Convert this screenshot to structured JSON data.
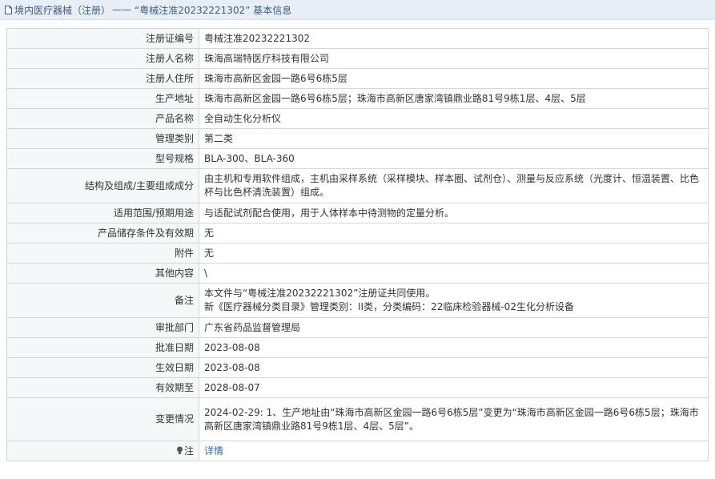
{
  "header": {
    "breadcrumb_prefix": "境内医疗器械（注册）",
    "separator": "——",
    "title": "“粤械注准20232221302” 基本信息"
  },
  "rows": [
    {
      "label": "注册证编号",
      "value": "粤械注准20232221302"
    },
    {
      "label": "注册人名称",
      "value": "珠海高瑞特医疗科技有限公司"
    },
    {
      "label": "注册人住所",
      "value": "珠海市高新区金园一路6号6栋5层"
    },
    {
      "label": "生产地址",
      "value": "珠海市高新区金园一路6号6栋5层；珠海市高新区唐家湾镇鼎业路81号9栋1层、4层、5层"
    },
    {
      "label": "产品名称",
      "value": "全自动生化分析仪"
    },
    {
      "label": "管理类别",
      "value": "第二类"
    },
    {
      "label": "型号规格",
      "value": "BLA-300、BLA-360"
    },
    {
      "label": "结构及组成/主要组成成分",
      "value": "由主机和专用软件组成，主机由采样系统（采样模块、样本圈、试剂仓）、测量与反应系统（光度计、恒温装置、比色杯与比色杯清洗装置）组成。"
    },
    {
      "label": "适用范围/预期用途",
      "value": "与适配试剂配合使用，用于人体样本中待测物的定量分析。"
    },
    {
      "label": "产品储存条件及有效期",
      "value": "无"
    },
    {
      "label": "附件",
      "value": "无"
    },
    {
      "label": "其他内容",
      "value": "\\"
    },
    {
      "label": "备注",
      "value_lines": [
        "本文件与“粤械注准20232221302”注册证共同使用。",
        "新《医疗器械分类目录》管理类别：II类，分类编码：22临床检验器械-02生化分析设备"
      ]
    },
    {
      "label": "审批部门",
      "value": "广东省药品监督管理局"
    },
    {
      "label": "批准日期",
      "value": "2023-08-08"
    },
    {
      "label": "生效日期",
      "value": "2023-08-08"
    },
    {
      "label": "有效期至",
      "value": "2028-08-07"
    },
    {
      "label": "变更情况",
      "value": "2024-02-29: 1、生产地址由“珠海市高新区金园一路6号6栋5层”变更为“珠海市高新区金园一路6号6栋5层；珠海市高新区唐家湾镇鼎业路81号9栋1层、4层、5层”。"
    }
  ],
  "note": {
    "label": "注",
    "icon": "bulb-icon",
    "link_text": "详情"
  },
  "colors": {
    "header_bg": "#e8eef5",
    "header_text": "#3a5d86",
    "label_bg": "#f6f7f9",
    "border": "#d6d6d6",
    "link": "#2a6bb3"
  }
}
